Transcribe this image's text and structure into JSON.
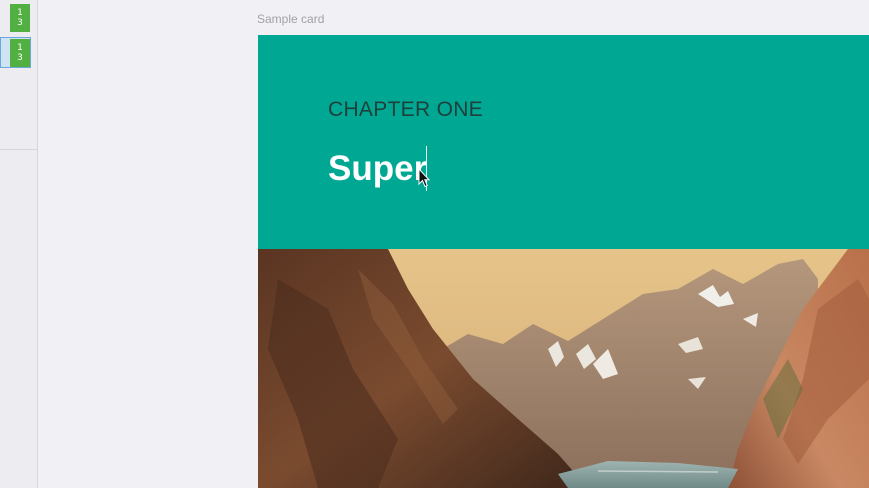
{
  "rail": {
    "slides": [
      {
        "line1": "1",
        "line2": "3",
        "selected": false
      },
      {
        "line1": "1",
        "line2": "3",
        "selected": true
      }
    ]
  },
  "canvas": {
    "label": "Sample card"
  },
  "card": {
    "eyebrow": "CHAPTER ONE",
    "headline": "Super",
    "header_color": "#00a893",
    "image_subject": "fjord-mountains-photo"
  },
  "colors": {
    "accent": "#00a893",
    "slide_thumb": "#52b043",
    "selection": "#6aa7dc"
  }
}
